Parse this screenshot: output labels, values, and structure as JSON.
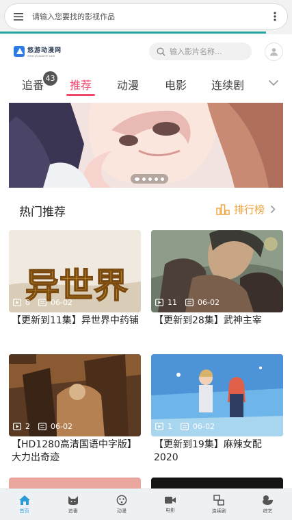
{
  "browser": {
    "url_placeholder": "请输入您要找的影视作品",
    "load_progress": 0.91
  },
  "header": {
    "logo_name": "悠游动漫网",
    "logo_sub": "www.yiyouanm.com",
    "search_placeholder": "输入影片名称..."
  },
  "tabs": {
    "items": [
      {
        "label": "追番",
        "badge": "43"
      },
      {
        "label": "推荐",
        "active": true
      },
      {
        "label": "动漫"
      },
      {
        "label": "电影"
      },
      {
        "label": "连续剧"
      }
    ]
  },
  "banner": {
    "slide_count": 5,
    "active_index": 0
  },
  "section": {
    "title": "热门推荐",
    "ranking_label": "排行榜"
  },
  "cards": [
    {
      "episodes": "8",
      "date": "06-02",
      "title": "【更新到11集】异世界中药铺",
      "art_text": "异世界"
    },
    {
      "episodes": "11",
      "date": "06-02",
      "title": "【更新到28集】武神主宰"
    },
    {
      "episodes": "2",
      "date": "06-02",
      "title": "【HD1280高清国语中字版】大力出奇迹"
    },
    {
      "episodes": "1",
      "date": "06-02",
      "title": "【更新到19集】麻辣女配2020"
    }
  ],
  "bottom_nav": {
    "items": [
      {
        "label": "首页",
        "icon": "home-icon",
        "active": true
      },
      {
        "label": "追番",
        "icon": "cat-icon"
      },
      {
        "label": "动漫",
        "icon": "face-icon"
      },
      {
        "label": "电影",
        "icon": "camera-icon"
      },
      {
        "label": "连续剧",
        "icon": "screens-icon"
      },
      {
        "label": "综艺",
        "icon": "duck-icon"
      }
    ]
  },
  "colors": {
    "accent": "#f2486e",
    "rank": "#f0a23a",
    "progress": "#23a6a0",
    "nav_active": "#2a9bd4"
  }
}
